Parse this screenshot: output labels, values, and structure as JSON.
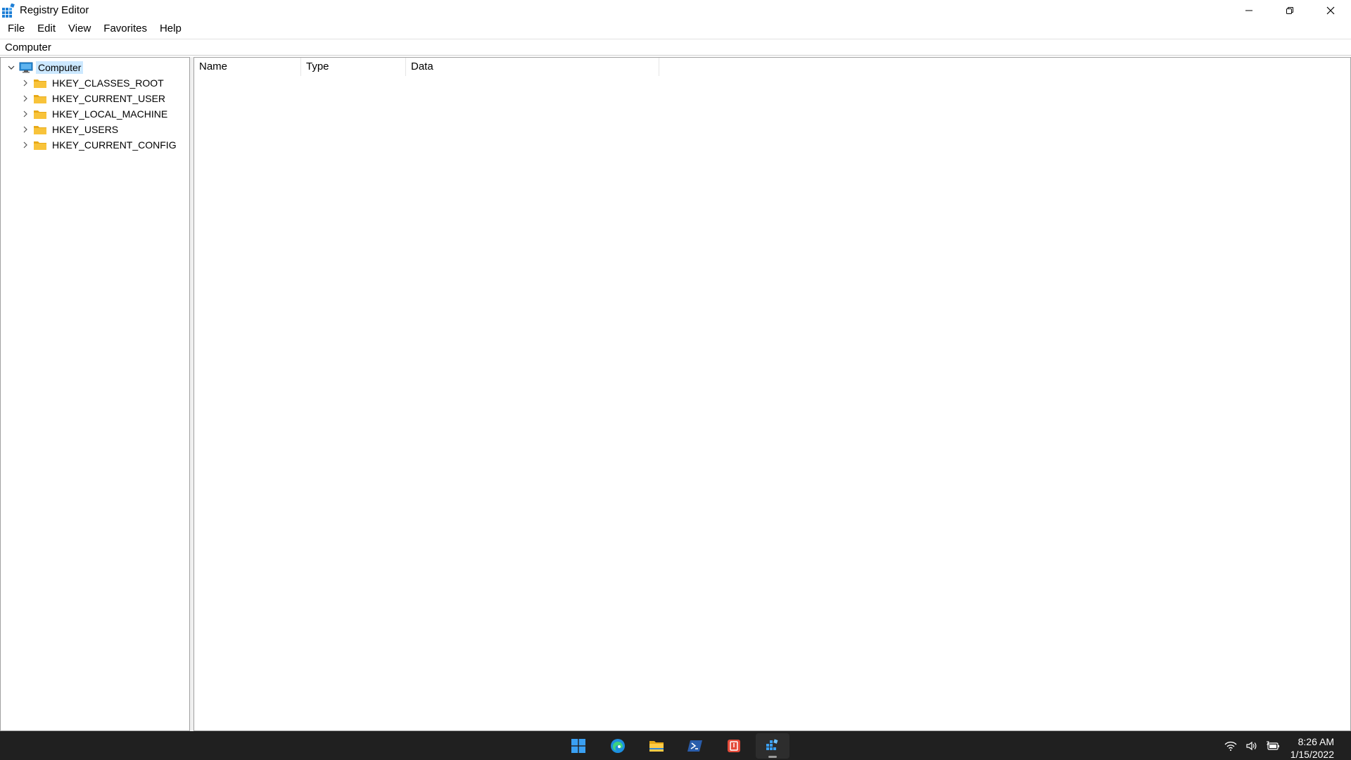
{
  "window": {
    "title": "Registry Editor",
    "icon": "registry-editor-icon",
    "controls": [
      "minimize-icon",
      "restore-icon",
      "close-icon"
    ]
  },
  "menu": {
    "items": [
      "File",
      "Edit",
      "View",
      "Favorites",
      "Help"
    ]
  },
  "address": {
    "path": "Computer"
  },
  "tree": {
    "root": {
      "label": "Computer",
      "icon": "computer-icon",
      "expanded": true,
      "selected": true
    },
    "hives": [
      {
        "label": "HKEY_CLASSES_ROOT",
        "icon": "folder-icon"
      },
      {
        "label": "HKEY_CURRENT_USER",
        "icon": "folder-icon"
      },
      {
        "label": "HKEY_LOCAL_MACHINE",
        "icon": "folder-icon"
      },
      {
        "label": "HKEY_USERS",
        "icon": "folder-icon"
      },
      {
        "label": "HKEY_CURRENT_CONFIG",
        "icon": "folder-icon"
      }
    ]
  },
  "list": {
    "columns": [
      "Name",
      "Type",
      "Data"
    ]
  },
  "taskbar": {
    "apps": [
      {
        "name": "start-icon"
      },
      {
        "name": "edge-icon"
      },
      {
        "name": "file-explorer-icon"
      },
      {
        "name": "powershell-icon"
      },
      {
        "name": "office-icon"
      },
      {
        "name": "registry-editor-icon",
        "active": true
      }
    ],
    "tray": [
      "wifi-icon",
      "volume-icon",
      "battery-icon"
    ],
    "time": "8:26 AM",
    "date": "1/15/2022"
  },
  "colors": {
    "selection": "#cce8ff",
    "taskbar": "#202020",
    "folder": "#f8c33a"
  }
}
